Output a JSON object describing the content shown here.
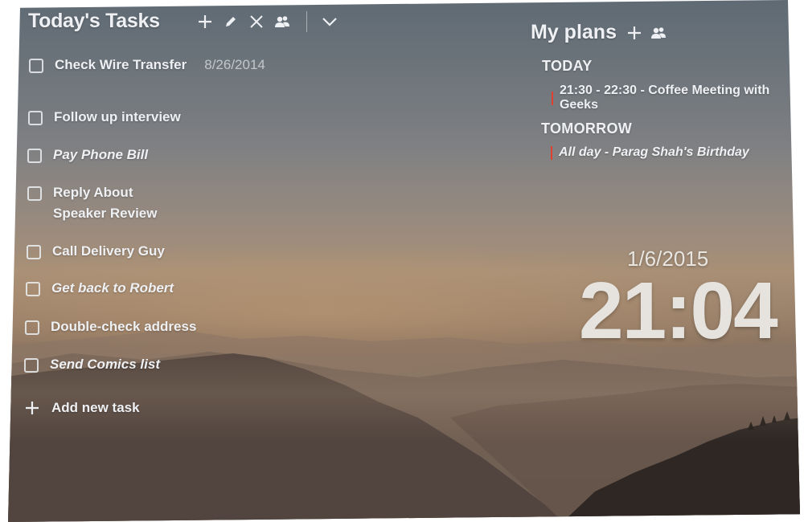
{
  "tasks_panel": {
    "title": "Today's Tasks",
    "tools": [
      "plus-icon",
      "pencil-icon",
      "close-icon",
      "people-icon",
      "chevron-down-icon"
    ],
    "items": [
      {
        "label": "Check Wire Transfer",
        "date": "8/26/2014",
        "italic": false
      },
      {
        "label": "Follow up interview",
        "italic": false
      },
      {
        "label": "Pay Phone Bill",
        "italic": true
      },
      {
        "label": "Reply About Speaker Review",
        "italic": false
      },
      {
        "label": "Call Delivery Guy",
        "italic": false
      },
      {
        "label": "Get back to Robert",
        "italic": true
      },
      {
        "label": "Double-check address",
        "italic": false
      },
      {
        "label": "Send Comics list",
        "italic": true
      }
    ],
    "add_label": "Add new task"
  },
  "plans_panel": {
    "title": "My plans",
    "tools": [
      "plus-icon",
      "people-icon"
    ],
    "days": [
      {
        "label": "TODAY",
        "events": [
          {
            "text": "21:30 - 22:30 - Coffee Meeting with Geeks",
            "italic": false
          }
        ]
      },
      {
        "label": "TOMORROW",
        "events": [
          {
            "text": "All day - Parag Shah's Birthday",
            "italic": true
          }
        ]
      }
    ],
    "event_bar_color": "#e0402f"
  },
  "clock": {
    "date": "1/6/2015",
    "time": "21:04"
  }
}
